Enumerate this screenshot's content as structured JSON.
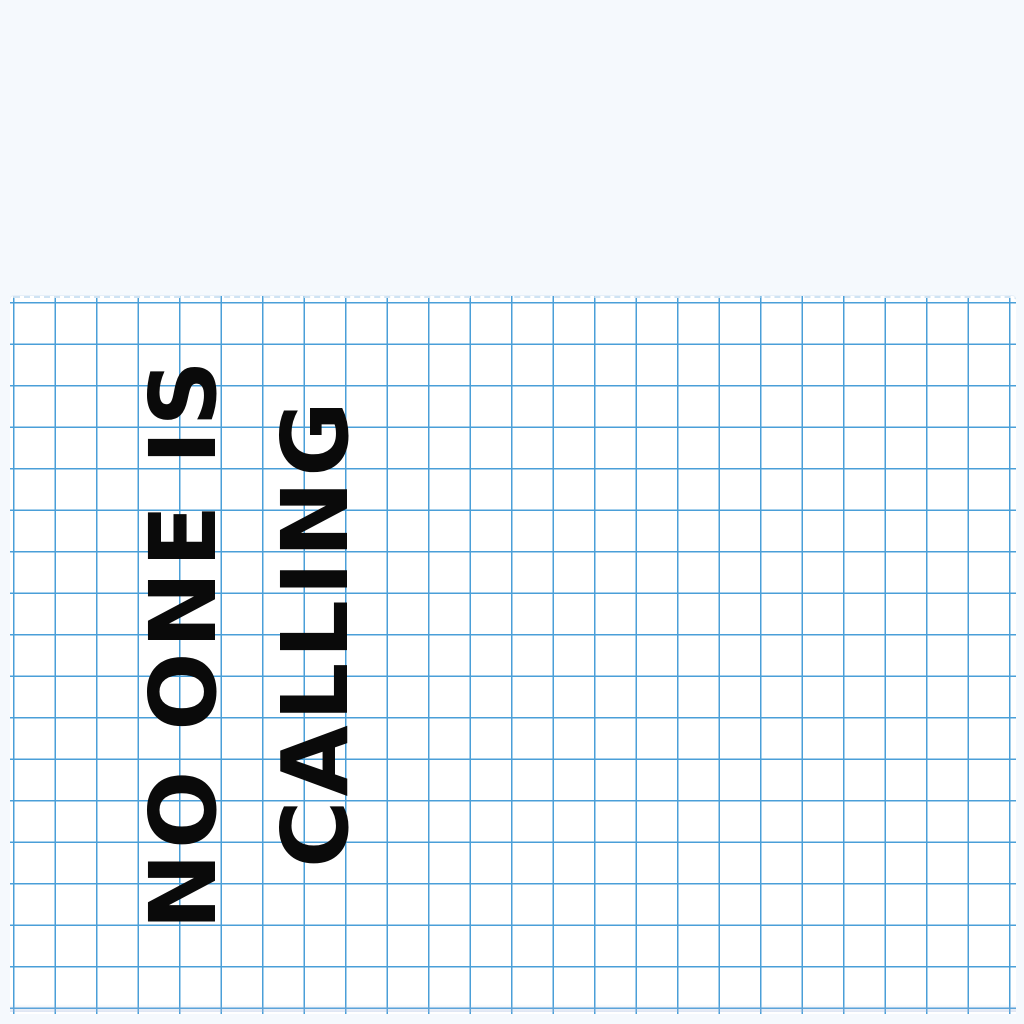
{
  "note": {
    "line1": "NO ONE IS",
    "line2": "CALLING"
  },
  "colors": {
    "paper": "#ffffff",
    "grid": "#4a9fd8",
    "ink": "#0a0a0a",
    "background": "#f5f9fd"
  }
}
